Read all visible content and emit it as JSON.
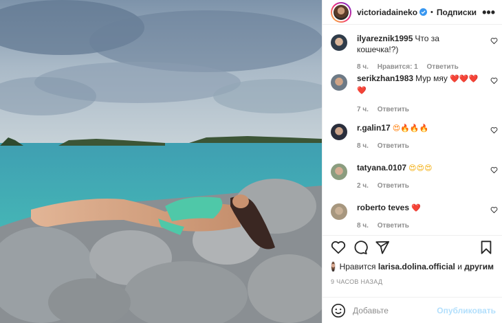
{
  "header": {
    "username": "victoriadaineko",
    "separator": "•",
    "follow_label": "Подписки",
    "more_label": "•••"
  },
  "comments": [
    {
      "user": "ilyareznik1995",
      "text": "Что за кошечка!?)",
      "time": "8 ч.",
      "likes": "Нравится: 1",
      "reply": "Ответить"
    },
    {
      "user": "serikzhan1983",
      "text": "Мур мяу",
      "emoji": "❤️❤️❤️❤️",
      "time": "7 ч.",
      "reply": "Ответить"
    },
    {
      "user": "r.galin17",
      "text": "",
      "emoji": "😍🔥🔥🔥",
      "time": "8 ч.",
      "reply": "Ответить"
    },
    {
      "user": "tatyana.0107",
      "text": "",
      "emoji": "😍😍😍",
      "time": "2 ч.",
      "reply": "Ответить"
    },
    {
      "user": "roberto teves",
      "text": "",
      "emoji": "❤️",
      "time": "8 ч.",
      "reply": "Ответить"
    }
  ],
  "likes": {
    "prefix": "Нравится",
    "user": "larisa.dolina.official",
    "and": "и",
    "others": "другим"
  },
  "timestamp": "9 ЧАСОВ НАЗАД",
  "add_comment": {
    "placeholder": "Добавьте",
    "publish_label": "Опубликовать"
  },
  "icons": [
    "verified-badge-icon",
    "heart-icon",
    "comment-icon",
    "share-icon",
    "bookmark-icon",
    "emoji-icon"
  ],
  "colors": {
    "accent": "#0095f6",
    "publish_disabled": "#b2dffc",
    "heart": "#ed4956",
    "muted": "#8e8e8e"
  }
}
